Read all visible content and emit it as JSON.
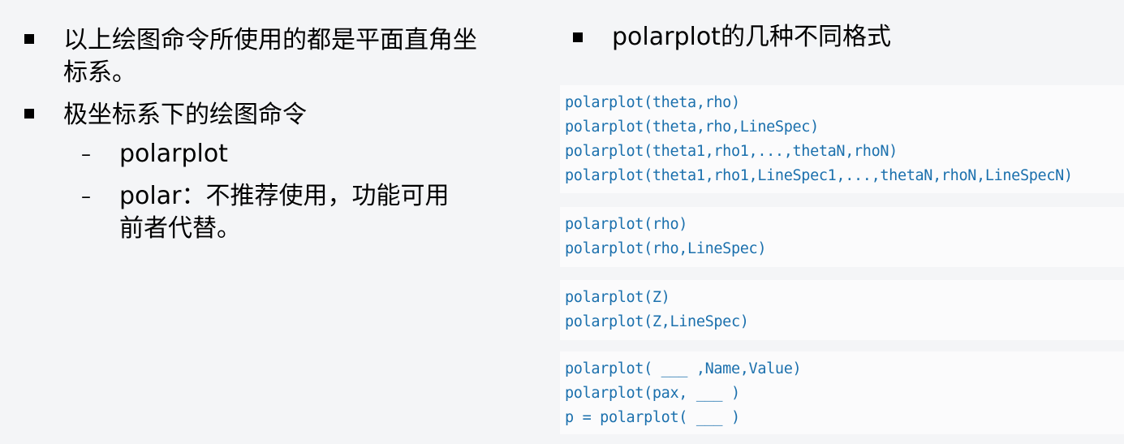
{
  "left_bullets": [
    "以上绘图命令所使用的都是平面直角坐标系。",
    "极坐标系下的绘图命令"
  ],
  "sub_bullets": [
    {
      "dash": "–",
      "text": "polarplot"
    },
    {
      "dash": "–",
      "text": "polar：不推荐使用，功能可用前者代替。"
    }
  ],
  "right_heading": "polarplot的几种不同格式",
  "code_blocks": [
    [
      "polarplot(theta,rho)",
      "polarplot(theta,rho,LineSpec)",
      "polarplot(theta1,rho1,...,thetaN,rhoN)",
      "polarplot(theta1,rho1,LineSpec1,...,thetaN,rhoN,LineSpecN)"
    ],
    [
      "polarplot(rho)",
      "polarplot(rho,LineSpec)"
    ],
    [
      "polarplot(Z)",
      "polarplot(Z,LineSpec)"
    ],
    [
      "polarplot( ___ ,Name,Value)",
      "polarplot(pax, ___ )",
      "p = polarplot( ___ )"
    ]
  ],
  "colors": {
    "background": "#f4f5f7",
    "code_background": "#fbfbfc",
    "code_text": "#1b70ad",
    "text": "#000000"
  }
}
